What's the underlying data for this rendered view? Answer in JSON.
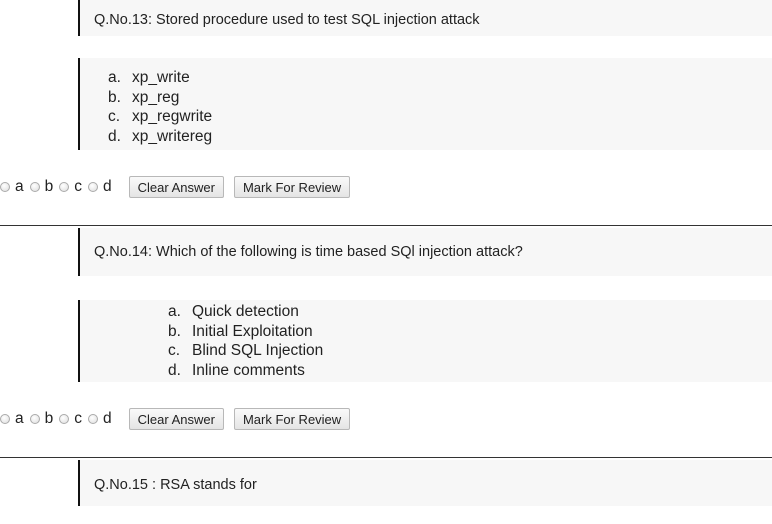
{
  "questions": [
    {
      "text": "Q.No.13: Stored procedure used to test SQL injection attack",
      "options": [
        {
          "letter": "a.",
          "text": "xp_write"
        },
        {
          "letter": "b.",
          "text": "xp_reg"
        },
        {
          "letter": "c.",
          "text": "xp_regwrite"
        },
        {
          "letter": "d.",
          "text": "xp_writereg"
        }
      ]
    },
    {
      "text": "Q.No.14: Which of the following is time based SQl injection attack?",
      "options": [
        {
          "letter": "a.",
          "text": "Quick detection"
        },
        {
          "letter": "b.",
          "text": "Initial Exploitation"
        },
        {
          "letter": "c.",
          "text": "Blind SQL Injection"
        },
        {
          "letter": "d.",
          "text": "Inline comments"
        }
      ]
    },
    {
      "text": "Q.No.15 : RSA stands for"
    }
  ],
  "answer_controls": {
    "radio_labels": [
      "a",
      "b",
      "c",
      "d"
    ],
    "clear_label": "Clear Answer",
    "review_label": "Mark For Review"
  }
}
